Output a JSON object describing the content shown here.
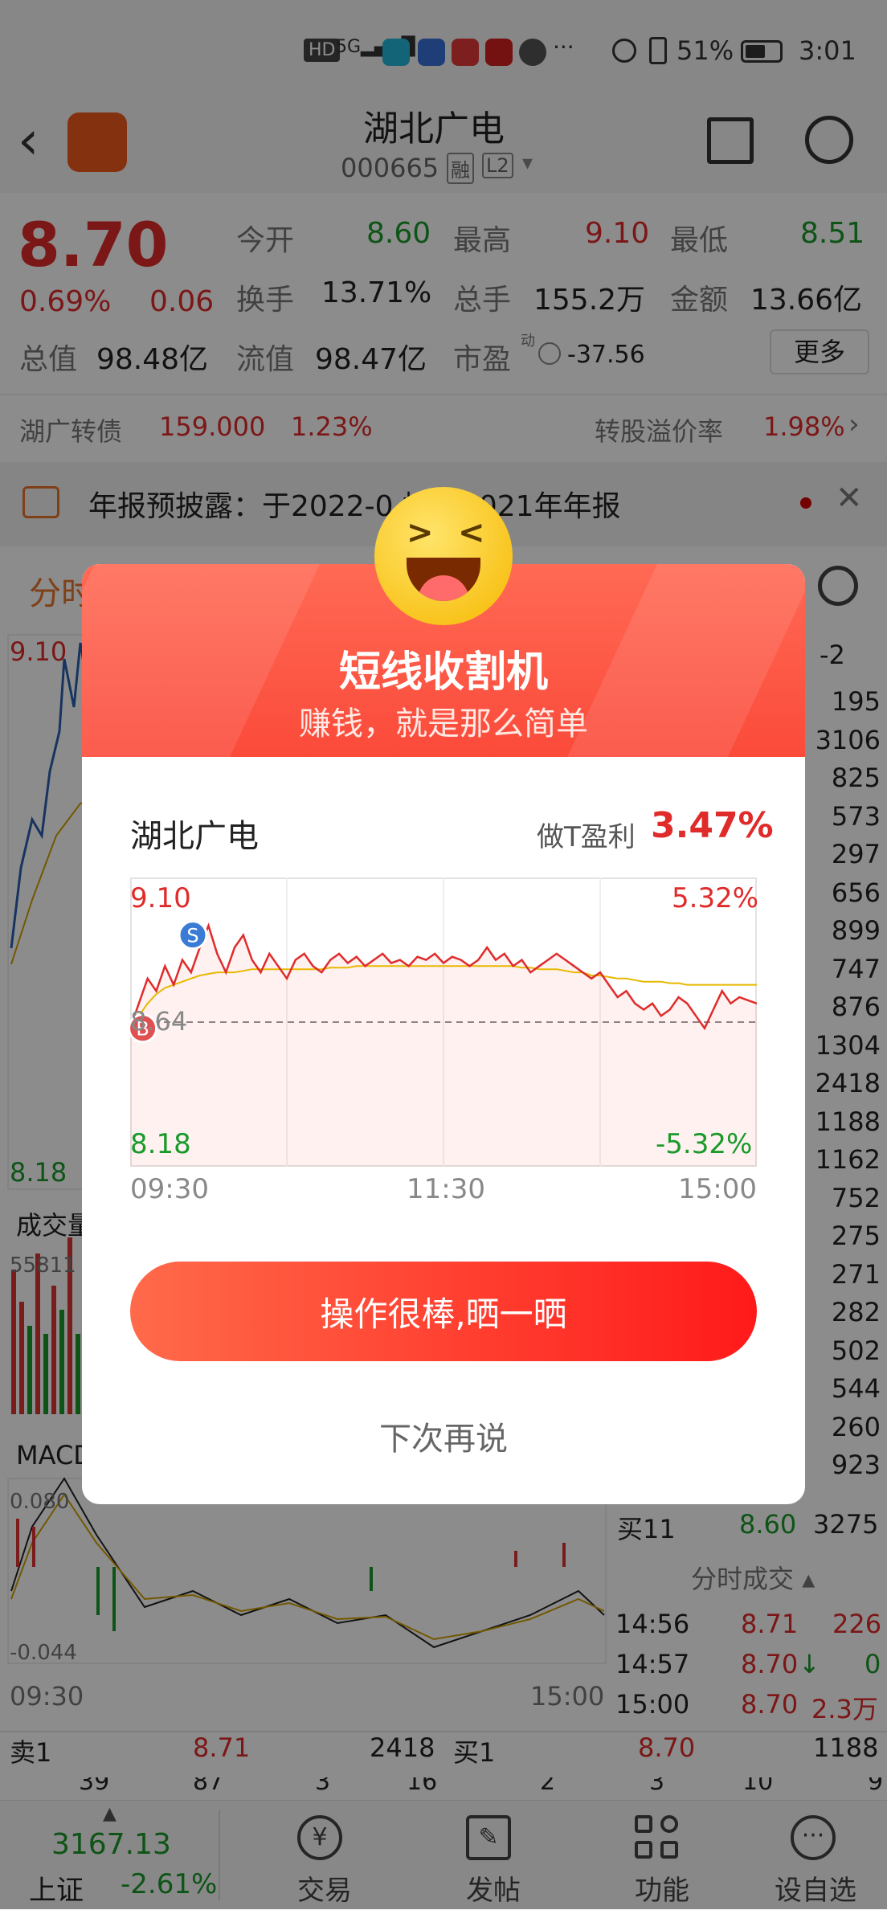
{
  "status_bar": {
    "time": "3:01",
    "battery": "51%",
    "dots": "···",
    "signal": "5G"
  },
  "header": {
    "title": "湖北广电",
    "code": "000665",
    "tag1": "融",
    "tag2": "L2"
  },
  "quote": {
    "price": "8.70",
    "pct": "0.69%",
    "change": "0.06",
    "open_label": "今开",
    "open": "8.60",
    "high_label": "最高",
    "high": "9.10",
    "low_label": "最低",
    "low": "8.51",
    "turnover_label": "换手",
    "turnover": "13.71%",
    "vol_label": "总手",
    "vol": "155.2万",
    "amount_label": "金额",
    "amount": "13.66亿",
    "mcap_label": "总值",
    "mcap": "98.48亿",
    "float_label": "流值",
    "float": "98.47亿",
    "pe_label": "市盈",
    "pe_sup": "动",
    "pe": "-37.56",
    "more": "更多"
  },
  "bond": {
    "name": "湖广转债",
    "price": "159.000",
    "pct": "1.23%",
    "premium_label": "转股溢价率",
    "premium": "1.98%"
  },
  "notice": {
    "text": "年报预披露：于2022-0  披露2021年年报"
  },
  "tabs": {
    "first": "分时"
  },
  "background_chart": {
    "top_price": "9.10",
    "mid_price": "8.64",
    "bottom_price": "8.18",
    "vol_label": "成交量",
    "vol_value": "55811",
    "macd_label": "MACD",
    "macd_hi": "0.080",
    "macd_lo": "-0.044",
    "t_start": "09:30",
    "t_end": "15:00",
    "right_tag": "-2"
  },
  "side_volumes": [
    "195",
    "3106",
    "825",
    "573",
    "297",
    "656",
    "899",
    "747",
    "876",
    "1304",
    "2418",
    "1188",
    "1162",
    "752",
    "275",
    "271",
    "282",
    "502",
    "544",
    "260",
    "923"
  ],
  "bid": {
    "label": "买11",
    "price": "8.60",
    "vol": "3275"
  },
  "ticks_title": "分时成交",
  "ticks": [
    {
      "time": "14:56",
      "price": "8.71",
      "vol": "226",
      "dir": ""
    },
    {
      "time": "14:57",
      "price": "8.70",
      "vol": "0",
      "dir": "↓"
    },
    {
      "time": "15:00",
      "price": "8.70",
      "vol": "2.3万",
      "dir": ""
    }
  ],
  "orderbook": {
    "sell_label": "卖1",
    "sell_price": "8.71",
    "sell_vol": "2418",
    "buy_label": "买1",
    "buy_price": "8.70",
    "buy_vol": "1188"
  },
  "orderbook_row2": {
    "left": [
      "39",
      "87",
      "3",
      "16"
    ],
    "right": [
      "2",
      "3",
      "10",
      "9"
    ]
  },
  "bottom_nav": {
    "index_value": "3167.13",
    "index_name": "上证",
    "index_pct": "-2.61%",
    "items": [
      "交易",
      "发帖",
      "功能",
      "设自选"
    ]
  },
  "modal": {
    "title": "短线收割机",
    "subtitle": "赚钱，就是那么简单",
    "stock": "湖北广电",
    "profit_label": "做T盈利",
    "profit": "3.47%",
    "cta": "操作很棒,晒一晒",
    "dismiss": "下次再说"
  },
  "chart_data": {
    "type": "line",
    "title": "",
    "y_top": "9.10",
    "y_mid": "8.64",
    "y_bottom": "8.18",
    "pct_top": "5.32%",
    "pct_bottom": "-5.32%",
    "x_ticks": [
      "09:30",
      "11:30",
      "15:00"
    ],
    "ylim": [
      8.18,
      9.1
    ],
    "markers": [
      {
        "label": "B",
        "t": 0.02,
        "price": 8.62
      },
      {
        "label": "S",
        "t": 0.1,
        "price": 8.92
      }
    ],
    "series": [
      {
        "values": [
          8.62,
          8.7,
          8.78,
          8.74,
          8.82,
          8.76,
          8.84,
          8.8,
          8.88,
          8.95,
          8.86,
          8.8,
          8.88,
          8.92,
          8.84,
          8.8,
          8.86,
          8.82,
          8.78,
          8.84,
          8.86,
          8.82,
          8.8,
          8.84,
          8.86,
          8.83,
          8.85,
          8.82,
          8.84,
          8.86,
          8.83,
          8.84,
          8.82,
          8.85,
          8.84,
          8.86,
          8.83,
          8.85,
          8.84,
          8.82,
          8.84,
          8.88,
          8.84,
          8.86,
          8.82,
          8.84,
          8.8,
          8.82,
          8.84,
          8.86,
          8.84,
          8.82,
          8.8,
          8.78,
          8.8,
          8.76,
          8.72,
          8.74,
          8.7,
          8.68,
          8.7,
          8.66,
          8.68,
          8.72,
          8.7,
          8.66,
          8.62,
          8.68,
          8.74,
          8.7,
          8.72,
          8.71,
          8.7
        ]
      },
      {
        "values": [
          8.62,
          8.66,
          8.7,
          8.73,
          8.75,
          8.76,
          8.77,
          8.78,
          8.79,
          8.795,
          8.8,
          8.8,
          8.8,
          8.805,
          8.81,
          8.81,
          8.81,
          8.81,
          8.81,
          8.81,
          8.81,
          8.81,
          8.81,
          8.815,
          8.815,
          8.815,
          8.82,
          8.82,
          8.82,
          8.82,
          8.82,
          8.82,
          8.82,
          8.82,
          8.82,
          8.82,
          8.82,
          8.82,
          8.82,
          8.82,
          8.82,
          8.82,
          8.82,
          8.82,
          8.82,
          8.815,
          8.815,
          8.81,
          8.81,
          8.81,
          8.805,
          8.8,
          8.8,
          8.79,
          8.79,
          8.785,
          8.78,
          8.78,
          8.775,
          8.77,
          8.77,
          8.77,
          8.765,
          8.765,
          8.76,
          8.76,
          8.76,
          8.76,
          8.76,
          8.76,
          8.76,
          8.76,
          8.76
        ]
      }
    ]
  }
}
